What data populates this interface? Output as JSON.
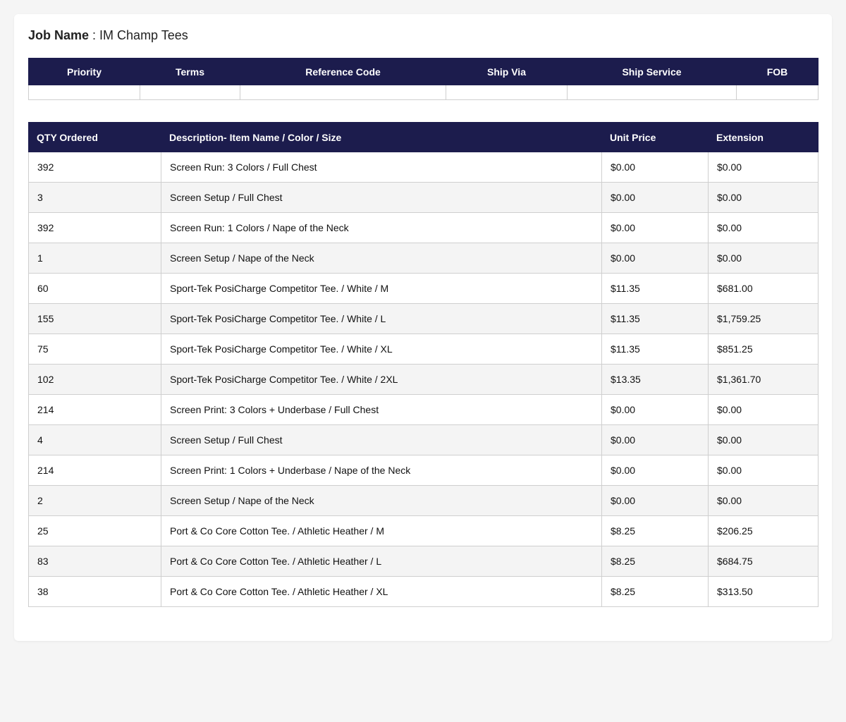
{
  "job": {
    "label": "Job Name",
    "separator": " : ",
    "value": "IM Champ Tees"
  },
  "meta_table": {
    "headers": [
      "Priority",
      "Terms",
      "Reference Code",
      "Ship Via",
      "Ship Service",
      "FOB"
    ],
    "values": [
      "",
      "",
      "",
      "",
      "",
      ""
    ]
  },
  "items_table": {
    "headers": [
      "QTY Ordered",
      "Description- Item Name / Color / Size",
      "Unit Price",
      "Extension"
    ],
    "rows": [
      {
        "qty": "392",
        "desc": "Screen Run: 3 Colors / Full Chest",
        "unit": "$0.00",
        "ext": "$0.00"
      },
      {
        "qty": "3",
        "desc": "Screen Setup / Full Chest",
        "unit": "$0.00",
        "ext": "$0.00"
      },
      {
        "qty": "392",
        "desc": "Screen Run: 1 Colors / Nape of the Neck",
        "unit": "$0.00",
        "ext": "$0.00"
      },
      {
        "qty": "1",
        "desc": "Screen Setup / Nape of the Neck",
        "unit": "$0.00",
        "ext": "$0.00"
      },
      {
        "qty": "60",
        "desc": "Sport-Tek PosiCharge Competitor Tee. / White / M",
        "unit": "$11.35",
        "ext": "$681.00"
      },
      {
        "qty": "155",
        "desc": "Sport-Tek PosiCharge Competitor Tee. / White / L",
        "unit": "$11.35",
        "ext": "$1,759.25"
      },
      {
        "qty": "75",
        "desc": "Sport-Tek PosiCharge Competitor Tee. / White / XL",
        "unit": "$11.35",
        "ext": "$851.25"
      },
      {
        "qty": "102",
        "desc": "Sport-Tek PosiCharge Competitor Tee. / White / 2XL",
        "unit": "$13.35",
        "ext": "$1,361.70"
      },
      {
        "qty": "214",
        "desc": "Screen Print: 3 Colors + Underbase / Full Chest",
        "unit": "$0.00",
        "ext": "$0.00"
      },
      {
        "qty": "4",
        "desc": "Screen Setup / Full Chest",
        "unit": "$0.00",
        "ext": "$0.00"
      },
      {
        "qty": "214",
        "desc": "Screen Print: 1 Colors + Underbase / Nape of the Neck",
        "unit": "$0.00",
        "ext": "$0.00"
      },
      {
        "qty": "2",
        "desc": "Screen Setup / Nape of the Neck",
        "unit": "$0.00",
        "ext": "$0.00"
      },
      {
        "qty": "25",
        "desc": "Port & Co Core Cotton Tee. / Athletic Heather / M",
        "unit": "$8.25",
        "ext": "$206.25"
      },
      {
        "qty": "83",
        "desc": "Port & Co Core Cotton Tee. / Athletic Heather / L",
        "unit": "$8.25",
        "ext": "$684.75"
      },
      {
        "qty": "38",
        "desc": "Port & Co Core Cotton Tee. / Athletic Heather / XL",
        "unit": "$8.25",
        "ext": "$313.50"
      }
    ]
  },
  "colors": {
    "header_bg": "#1c1c4d",
    "stripe_bg": "#f4f4f4"
  }
}
